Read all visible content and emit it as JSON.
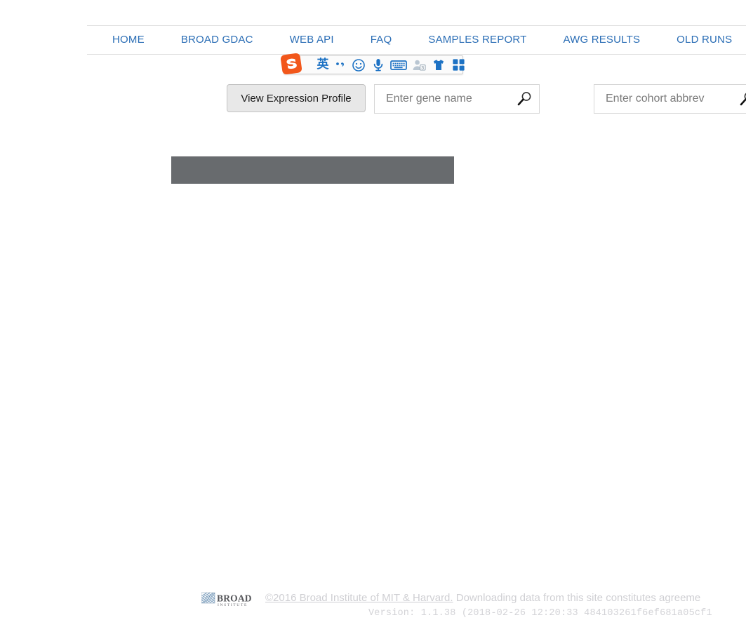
{
  "nav": {
    "items": [
      {
        "label": "HOME",
        "name": "nav-home"
      },
      {
        "label": "BROAD GDAC",
        "name": "nav-broad-gdac"
      },
      {
        "label": "WEB API",
        "name": "nav-web-api"
      },
      {
        "label": "FAQ",
        "name": "nav-faq"
      },
      {
        "label": "SAMPLES REPORT",
        "name": "nav-samples-report"
      },
      {
        "label": "AWG RESULTS",
        "name": "nav-awg-results"
      },
      {
        "label": "OLD RUNS",
        "name": "nav-old-runs"
      }
    ],
    "link_color": "#2a6db5"
  },
  "ime": {
    "app": "Sogou Pinyin IME toolbar",
    "logo_color": "#f2571b",
    "icon_color": "#1d72c4",
    "items": [
      {
        "name": "sogou-logo-icon",
        "label": "S"
      },
      {
        "name": "input-mode-english-icon",
        "label": "英"
      },
      {
        "name": "punctuation-mode-icon",
        "label": "、，"
      },
      {
        "name": "emoji-icon",
        "label": "emoji"
      },
      {
        "name": "voice-input-icon",
        "label": "microphone"
      },
      {
        "name": "soft-keyboard-icon",
        "label": "keyboard"
      },
      {
        "name": "user-account-icon",
        "label": "user"
      },
      {
        "name": "skin-theme-icon",
        "label": "t-shirt"
      },
      {
        "name": "toolbox-icon",
        "label": "grid"
      }
    ]
  },
  "controls": {
    "view_expression_button": "View Expression Profile",
    "gene_input": {
      "value": "",
      "placeholder": "Enter gene name"
    },
    "cohort_input": {
      "value": "",
      "placeholder": "Enter cohort abbrev"
    }
  },
  "content": {
    "placeholder_color": "#686b6e",
    "placeholder_text": ""
  },
  "footer": {
    "logo_title": "BROAD",
    "logo_subtitle": "INSTITUTE",
    "copyright_link": "©2016 Broad Institute of MIT & Harvard.",
    "copyright_rest": " Downloading data from this site constitutes agreeme",
    "version": "Version: 1.1.38 (2018-02-26 12:20:33 484103261f6ef681a05cf1",
    "text_color": "#cfcfd3"
  }
}
